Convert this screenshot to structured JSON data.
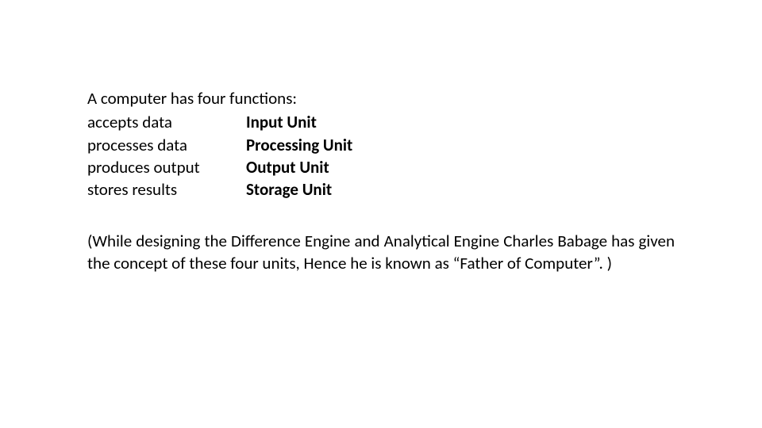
{
  "intro": "A computer has four functions:",
  "rows": [
    {
      "function": "accepts data",
      "unit": "Input Unit"
    },
    {
      "function": "processes data",
      "unit": "Processing Unit"
    },
    {
      "function": "produces output",
      "unit": "Output Unit"
    },
    {
      "function": "stores results",
      "unit": "Storage Unit"
    }
  ],
  "note": "(While designing the Difference Engine and Analytical Engine Charles Babage has given the concept of these four units, Hence he is known as “Father of Computer”. )"
}
